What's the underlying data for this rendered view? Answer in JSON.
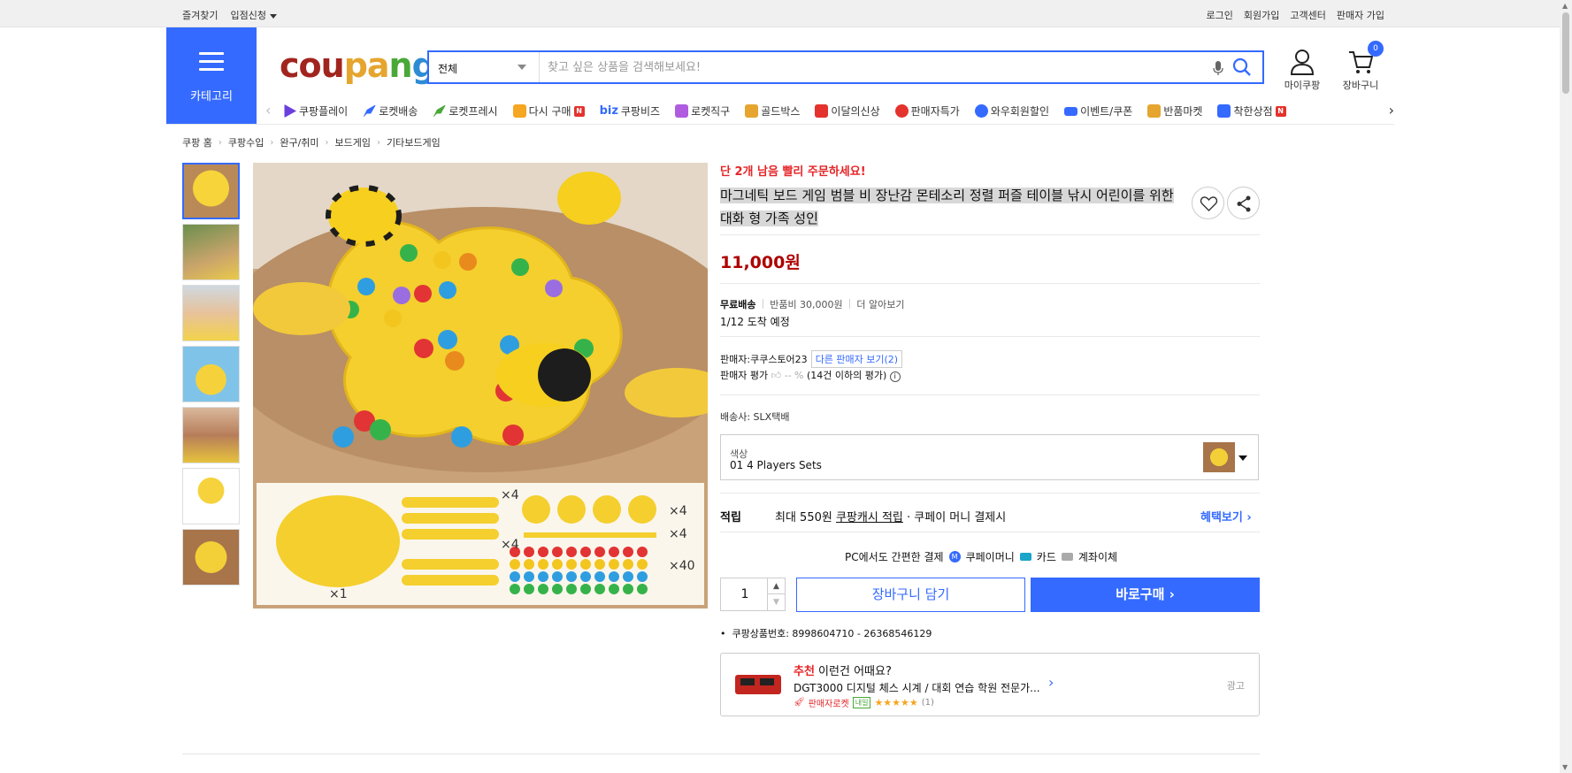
{
  "topbar": {
    "favorites": "즐겨찾기",
    "apply": "입점신청",
    "login": "로그인",
    "signup": "회원가입",
    "support": "고객센터",
    "seller_signup": "판매자 가입"
  },
  "header": {
    "category_label": "카테고리",
    "logo": {
      "c1": "cou",
      "c2": "pa",
      "c3": "n",
      "c4": "g"
    },
    "search_category": "전체",
    "search_placeholder": "찾고 싶은 상품을 검색해보세요!",
    "mycoupang": "마이쿠팡",
    "cart": "장바구니",
    "cart_count": "0"
  },
  "nav": {
    "items": [
      {
        "label": "쿠팡플레이",
        "icon": "play-icon",
        "color": "#6b3fdc"
      },
      {
        "label": "로켓배송",
        "icon": "rocket-icon",
        "color": "#346aff"
      },
      {
        "label": "로켓프레시",
        "icon": "rocket-fresh-icon",
        "color": "#49a838"
      },
      {
        "label": "다시 구매",
        "icon": "rebuy-icon",
        "color": "#f5a623",
        "badge": "N"
      },
      {
        "label": "biz",
        "label2": "쿠팡비즈",
        "icon": "biz-icon",
        "color": "#346aff"
      },
      {
        "label": "로켓직구",
        "icon": "global-icon",
        "color": "#b05ce0"
      },
      {
        "label": "골드박스",
        "icon": "goldbox-icon",
        "color": "#e5a52e"
      },
      {
        "label": "이달의신상",
        "icon": "new-icon",
        "color": "#e4322d"
      },
      {
        "label": "판매자특가",
        "icon": "percent-icon",
        "color": "#e4322d"
      },
      {
        "label": "와우회원할인",
        "icon": "wow-icon",
        "color": "#346aff"
      },
      {
        "label": "이벤트/쿠폰",
        "icon": "event-icon",
        "color": "#346aff"
      },
      {
        "label": "반품마켓",
        "icon": "return-market-icon",
        "color": "#e5a52e"
      },
      {
        "label": "착한상점",
        "icon": "good-store-icon",
        "color": "#346aff",
        "badge": "N"
      }
    ]
  },
  "breadcrumb": [
    "쿠팡 홈",
    "쿠팡수입",
    "완구/취미",
    "보드게임",
    "기타보드게임"
  ],
  "product": {
    "stock_notice": "단 2개 남음 빨리 주문하세요!",
    "title": "마그네틱 보드 게임 범블 비 장난감 몬테소리 정렬 퍼즐 테이블 낚시 어린이를 위한 대화 형 가족 성인",
    "price": "11,000원",
    "shipping": {
      "free": "무료배송",
      "return_fee": "반품비 30,000원",
      "more": "더 알아보기",
      "arrival": "1/12 도착 예정"
    },
    "seller": {
      "label": "판매자:",
      "name": "쿠쿠스토어23",
      "other": "다른 판매자 보기(2)",
      "rating_label": "판매자 평가",
      "rating_value": "-- %",
      "rating_note": "(14건 이하의 평가)"
    },
    "carrier": "배송사:  SLX택배",
    "option": {
      "label": "색상",
      "value": "01 4 Players Sets"
    },
    "benefit": {
      "label": "적립",
      "prefix": "최대 550원 ",
      "link": "쿠팡캐시 적립",
      "suffix": " · 쿠페이 머니 결제시",
      "more": "혜택보기"
    },
    "payment": {
      "label": "PC에서도 간편한 결제",
      "money": "쿠페이머니",
      "card": "카드",
      "account": "계좌이체"
    },
    "quantity": "1",
    "add_cart": "장바구니 담기",
    "buy_now": "바로구매",
    "product_no": "쿠팡상품번호: 8998604710 - 26368546129"
  },
  "recommend": {
    "highlight": "추천",
    "title": " 이런건 어때요?",
    "item": "DGT3000 디지털 체스 시계 / 대회 연습 학원 전문가...",
    "seller_rocket": "판매자로켓",
    "tomorrow": "내일",
    "stars": "★★★★★",
    "count": "(1)",
    "ad": "광고"
  }
}
